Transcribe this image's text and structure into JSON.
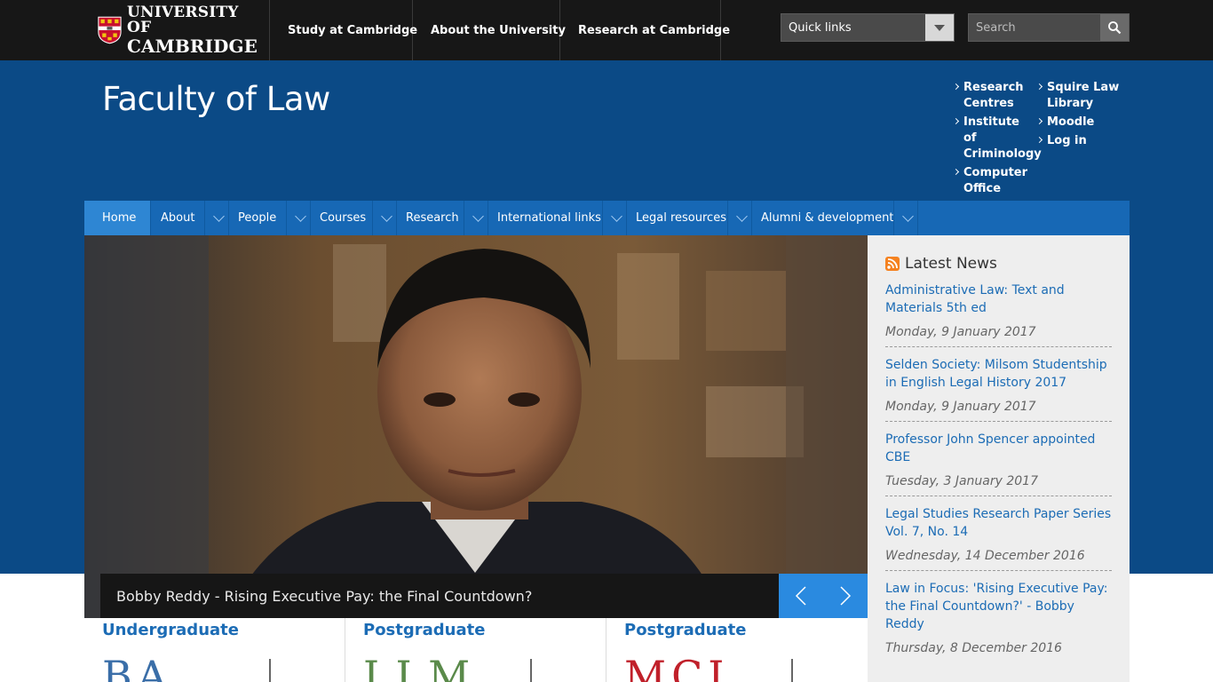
{
  "brand": {
    "line1": "UNIVERSITY OF",
    "line2": "CAMBRIDGE"
  },
  "topnav": [
    {
      "label": "Study at Cambridge"
    },
    {
      "label": "About the University"
    },
    {
      "label": "Research at Cambridge"
    }
  ],
  "quicklinks": {
    "label": "Quick links"
  },
  "search": {
    "placeholder": "Search",
    "value": ""
  },
  "header": {
    "title": "Faculty of Law",
    "links_col1": [
      {
        "label": "Research Centres"
      },
      {
        "label": "Institute of Criminology"
      },
      {
        "label": "Computer Office"
      }
    ],
    "links_col2": [
      {
        "label": "Squire Law Library"
      },
      {
        "label": "Moodle"
      },
      {
        "label": "Log in"
      }
    ]
  },
  "mainnav": [
    {
      "label": "Home"
    },
    {
      "label": "About"
    },
    {
      "label": "People"
    },
    {
      "label": "Courses"
    },
    {
      "label": "Research"
    },
    {
      "label": "International links"
    },
    {
      "label": "Legal resources"
    },
    {
      "label": "Alumni & development"
    }
  ],
  "hero": {
    "caption": "Bobby Reddy - Rising Executive Pay: the Final Countdown?"
  },
  "news": {
    "title": "Latest News",
    "items": [
      {
        "title": "Administrative Law: Text and Materials 5th ed",
        "date": "Monday, 9 January 2017"
      },
      {
        "title": "Selden Society: Milsom Studentship in English Legal History 2017",
        "date": "Monday, 9 January 2017"
      },
      {
        "title": "Professor John Spencer appointed CBE",
        "date": "Tuesday, 3 January 2017"
      },
      {
        "title": "Legal Studies Research Paper Series Vol. 7, No. 14",
        "date": "Wednesday, 14 December 2016"
      },
      {
        "title": "Law in Focus: 'Rising Executive Pay: the Final Countdown?' - Bobby Reddy",
        "date": "Thursday, 8 December 2016"
      }
    ]
  },
  "cards": [
    {
      "heading": "Undergraduate",
      "big": "BA",
      "color": "#3a6ea8"
    },
    {
      "heading": "Postgraduate",
      "big": "LLM",
      "color": "#5a8a4a"
    },
    {
      "heading": "Postgraduate",
      "big": "MCL",
      "color": "#c0202a"
    }
  ],
  "colors": {
    "topbar": "#171717",
    "header": "#0b4a86",
    "nav": "#1768b5",
    "nav_active": "#2e86d3",
    "link": "#1c6cb5",
    "rss": "#f58220"
  }
}
